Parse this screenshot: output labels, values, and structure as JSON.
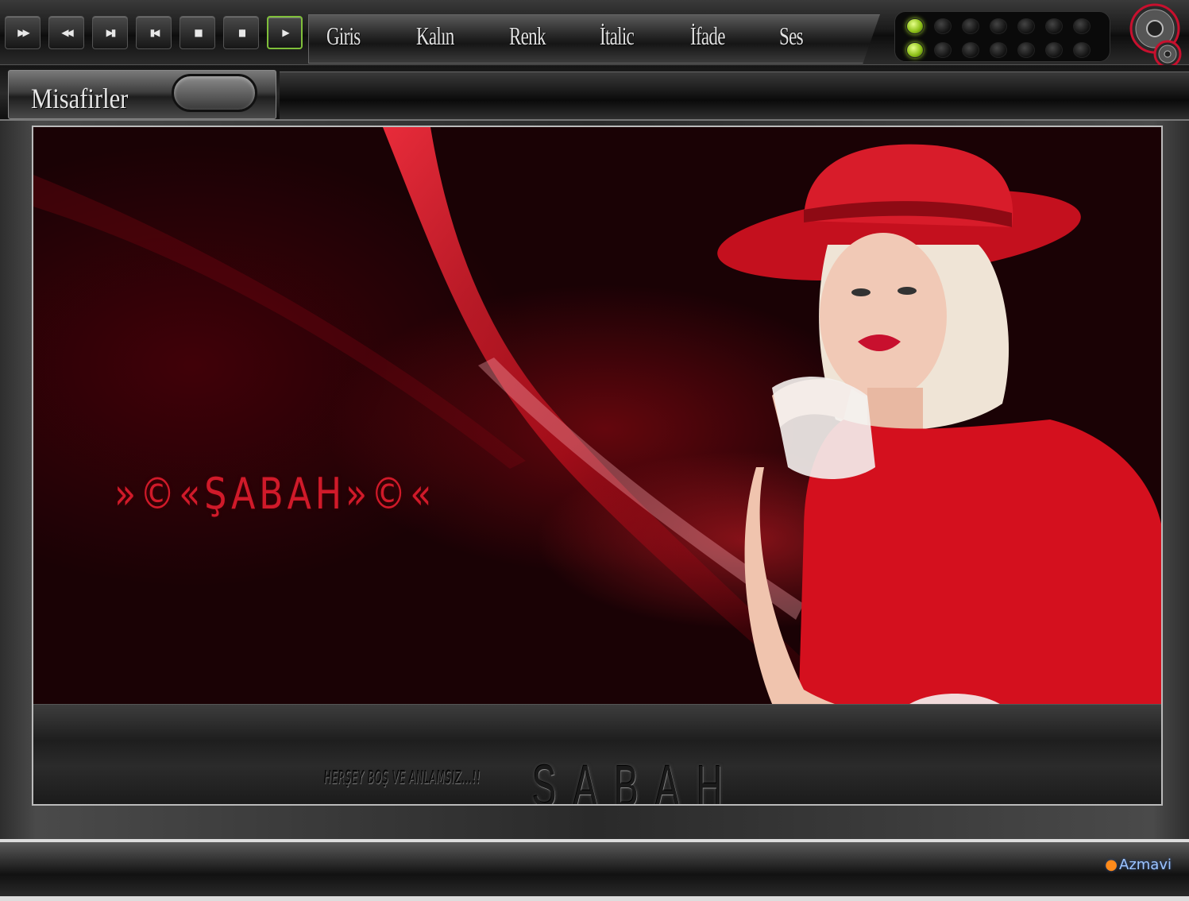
{
  "transport": {
    "buttons": [
      {
        "label": "▶▶",
        "name": "fast-forward"
      },
      {
        "label": "◀◀",
        "name": "rewind"
      },
      {
        "label": "▶▮",
        "name": "next-track"
      },
      {
        "label": "▮◀",
        "name": "previous-track"
      },
      {
        "label": "■",
        "name": "stop"
      },
      {
        "label": "▮▮",
        "name": "pause"
      },
      {
        "label": "▶",
        "name": "play"
      }
    ]
  },
  "menu": {
    "items": [
      "Giris",
      "Kalın",
      "Renk",
      "İtalic",
      "İfade",
      "Ses"
    ]
  },
  "leds": {
    "rows": 2,
    "per_row": 7,
    "lit": [
      0,
      0
    ]
  },
  "subbar": {
    "guests_label": "Misafirler"
  },
  "stage": {
    "signature": "»©«ŞABAH»©«",
    "motto": "HERŞEY BOŞ VE ANLAMSIZ...!!",
    "brand": "SABAH"
  },
  "footer": {
    "credit": "Azmavi"
  },
  "colors": {
    "accent_red": "#d01a2a",
    "led_green": "#8fc21a",
    "active_border": "#7fbf3a"
  }
}
